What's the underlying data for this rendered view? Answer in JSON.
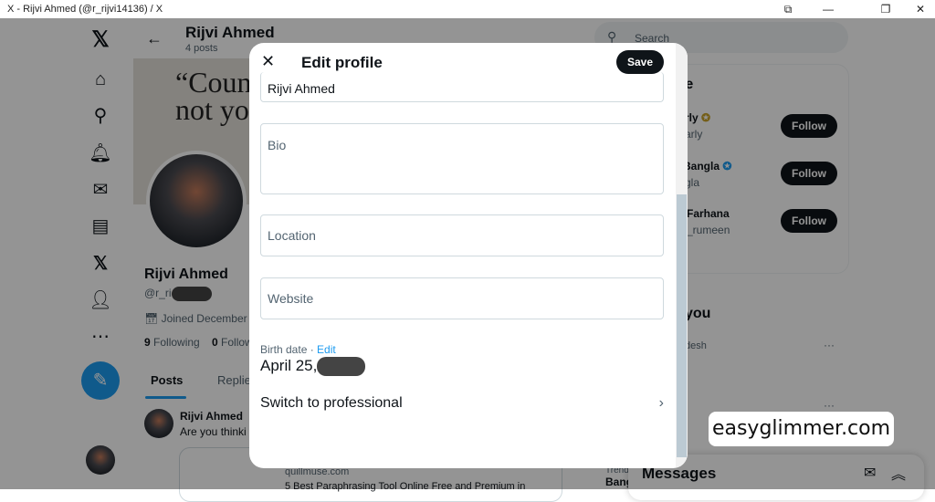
{
  "window": {
    "title": "X - Rijvi Ahmed (@r_rijvi14136) / X"
  },
  "nav": {
    "items": [
      "x-logo",
      "home",
      "explore",
      "notifications",
      "messages",
      "lists",
      "premium",
      "profile",
      "more"
    ]
  },
  "profile": {
    "name": "Rijvi Ahmed",
    "posts": "4 posts",
    "handle": "@r_ri",
    "joined": "Joined December",
    "following_count": "9",
    "following_label": "Following",
    "followers_count": "0",
    "followers_label": "Follow",
    "banner_line1": "“Coun",
    "banner_line2": "not yo",
    "tabs": [
      "Posts",
      "Replie"
    ],
    "post": {
      "author": "Rijvi Ahmed",
      "text": "Are you thinki",
      "link_domain": "quillmuse.com",
      "link_title": "5 Best Paraphrasing Tool Online Free and Premium in"
    }
  },
  "search": {
    "placeholder": "Search"
  },
  "who_to_follow": {
    "title": "ike",
    "items": [
      {
        "name": "rly",
        "handle": "arly",
        "badge_color": "#c9a227"
      },
      {
        "name": "s Bangla",
        "handle": "gla",
        "badge_color": "#1d9bf0"
      },
      {
        "name": "Farhana",
        "handle": "_rumeen"
      }
    ],
    "follow_label": "Follow"
  },
  "trends": {
    "title": "you",
    "item1": "desh",
    "trend_label": "Trend",
    "trend_name": "Bang"
  },
  "messages": {
    "title": "Messages"
  },
  "modal": {
    "title": "Edit profile",
    "save": "Save",
    "name_value": "Rijvi Ahmed",
    "bio_label": "Bio",
    "location_label": "Location",
    "website_label": "Website",
    "birth_label": "Birth date · ",
    "birth_edit": "Edit",
    "birth_value": "April 25,",
    "switch_pro": "Switch to professional"
  },
  "watermark": "easyglimmer.com"
}
